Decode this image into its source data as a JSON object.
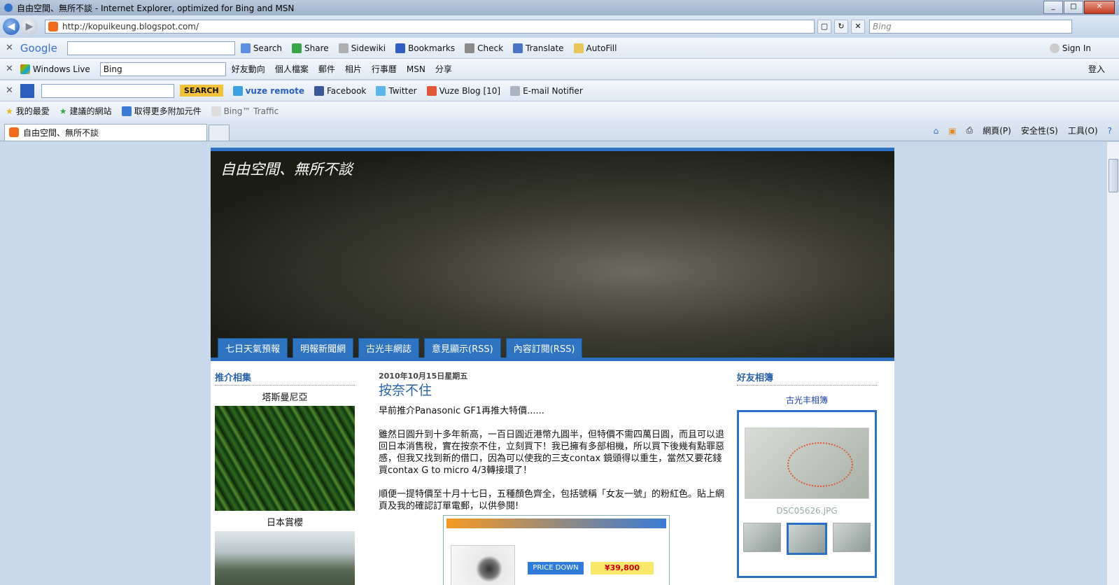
{
  "window": {
    "title": "自由空間、無所不談 - Internet Explorer, optimized for Bing and MSN"
  },
  "address": {
    "url": "http://kopuikeung.blogspot.com/",
    "search_placeholder": "Bing"
  },
  "google_toolbar": {
    "brand": "Google",
    "items": [
      "Search",
      "Share",
      "Sidewiki",
      "Bookmarks",
      "Check",
      "Translate",
      "AutoFill"
    ],
    "signin": "Sign In"
  },
  "wl_toolbar": {
    "brand": "Windows Live",
    "search_value": "Bing",
    "items": [
      "好友動向",
      "個人檔案",
      "郵件",
      "相片",
      "行事曆",
      "MSN",
      "分享"
    ],
    "login": "登入"
  },
  "vuze_toolbar": {
    "search_label": "SEARCH",
    "items": [
      "vuze remote",
      "Facebook",
      "Twitter",
      "Vuze Blog",
      "[10]",
      "E-mail Notifier"
    ]
  },
  "favorites_bar": {
    "items": [
      "我的最愛",
      "建議的網站",
      "取得更多附加元件",
      "Bing™ Traffic"
    ]
  },
  "tabs": {
    "active_tab": "自由空間、無所不談"
  },
  "command_bar": {
    "items": [
      "網頁(P)",
      "安全性(S)",
      "工具(O)"
    ]
  },
  "blog": {
    "title": "自由空間、無所不談",
    "nav": [
      "七日天氣預報",
      "明報新聞網",
      "古光丰網誌",
      "意見顯示(RSS)",
      "內容訂閱(RSS)"
    ],
    "left": {
      "heading": "推介相集",
      "album1": "塔斯曼尼亞",
      "album2": "日本賞櫻"
    },
    "post": {
      "date": "2010年10月15日星期五",
      "title": "按奈不住",
      "paragraphs": [
        "早前推介Panasonic GF1再推大特價......",
        "雖然日圓升到十多年新高，一百日圓近港幣九圓半，但特價不需四萬日圓，而且可以退回日本消售稅，實在按奈不住，立刻買下！我已擁有多部相機，所以買下後幾有點罪惡感，但我又找到新的借口，因為可以使我的三支contax 鏡頭得以重生，當然又要花錢買contax G to micro 4/3轉接環了！",
        "順便一提特價至十月十七日，五種顏色齊全，包括號稱「女友一號」的粉紅色。貼上網頁及我的確認訂單電郵，以供參閱!"
      ],
      "screenshot_price": "¥39,800"
    },
    "right": {
      "heading": "好友相簿",
      "album_title": "古光丰相簿",
      "filename": "DSC05626.JPG"
    }
  }
}
